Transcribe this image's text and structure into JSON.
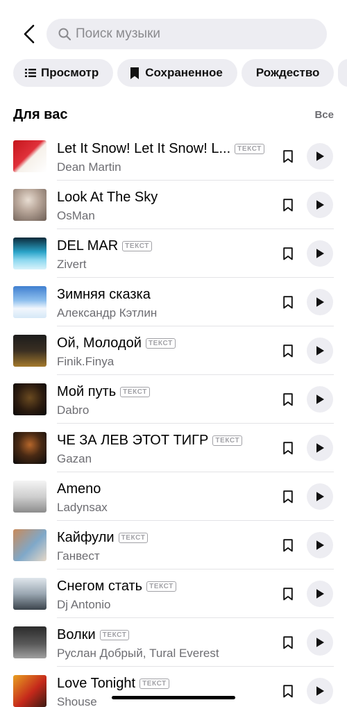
{
  "search": {
    "placeholder": "Поиск музыки"
  },
  "chips": [
    {
      "label": "Просмотр",
      "icon": "list-icon"
    },
    {
      "label": "Сохраненное",
      "icon": "bookmark-filled-icon"
    },
    {
      "label": "Рождество",
      "icon": ""
    }
  ],
  "section": {
    "title": "Для вас",
    "all_label": "Все"
  },
  "badge_label": "ТЕКСТ",
  "colors": {
    "accent_bg": "#ededf2",
    "secondary_text": "#6d6d72",
    "badge": "#a1a1a6"
  },
  "tracks": [
    {
      "title": "Let It Snow! Let It Snow! L...",
      "artist": "Dean Martin",
      "lyrics": true
    },
    {
      "title": "Look At The Sky",
      "artist": "OsMan",
      "lyrics": false
    },
    {
      "title": "DEL MAR",
      "artist": "Zivert",
      "lyrics": true
    },
    {
      "title": "Зимняя сказка",
      "artist": "Александр Кэтлин",
      "lyrics": false
    },
    {
      "title": "Ой, Молодой",
      "artist": "Finik.Finya",
      "lyrics": true
    },
    {
      "title": "Мой путь",
      "artist": "Dabro",
      "lyrics": true
    },
    {
      "title": "ЧЕ ЗА ЛЕВ ЭТОТ ТИГР",
      "artist": "Gazan",
      "lyrics": true
    },
    {
      "title": "Ameno",
      "artist": "Ladynsax",
      "lyrics": false
    },
    {
      "title": "Кайфули",
      "artist": "Ганвест",
      "lyrics": true
    },
    {
      "title": "Снегом стать",
      "artist": "Dj Antonio",
      "lyrics": true
    },
    {
      "title": "Волки",
      "artist": "Руслан Добрый, Tural Everest",
      "lyrics": true
    },
    {
      "title": "Love Tonight",
      "artist": "Shouse",
      "lyrics": true
    }
  ]
}
